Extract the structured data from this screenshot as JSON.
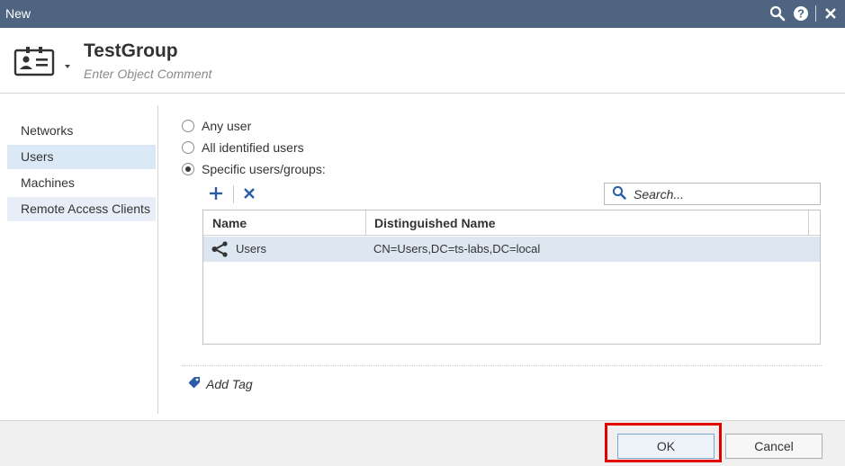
{
  "window": {
    "title": "New",
    "icons": [
      "search-icon",
      "help-icon",
      "close-icon"
    ]
  },
  "object": {
    "icon": "user-card-icon",
    "name": "TestGroup",
    "comment_placeholder": "Enter Object Comment"
  },
  "sidebar": {
    "items": [
      {
        "label": "Networks",
        "selected": false
      },
      {
        "label": "Users",
        "selected": true
      },
      {
        "label": "Machines",
        "selected": false
      },
      {
        "label": "Remote Access Clients",
        "selected": false
      }
    ]
  },
  "options": {
    "any_user": "Any user",
    "all_identified": "All identified users",
    "specific": "Specific users/groups:",
    "selected": "specific"
  },
  "toolbar": {
    "add_icon": "plus-icon",
    "remove_icon": "x-icon"
  },
  "search": {
    "placeholder": "Search...",
    "value": ""
  },
  "table": {
    "columns": [
      "Name",
      "Distinguished Name"
    ],
    "rows": [
      {
        "icon": "group-share-icon",
        "name": "Users",
        "dn": "CN=Users,DC=ts-labs,DC=local"
      }
    ]
  },
  "tag": {
    "label": "Add Tag",
    "icon": "tag-icon"
  },
  "footer": {
    "ok_label": "OK",
    "cancel_label": "Cancel"
  },
  "colors": {
    "titlebar": "#4f6480",
    "selection": "#dbe8f6",
    "row_selected": "#dde7f2",
    "highlight": "#e00000",
    "accent": "#2b5ea7"
  }
}
